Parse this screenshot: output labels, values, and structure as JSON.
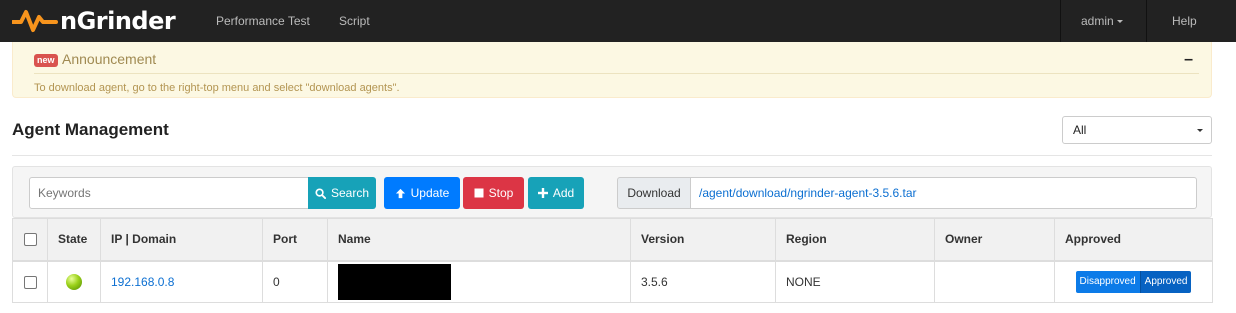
{
  "nav": {
    "brand": "nGrinder",
    "links": [
      "Performance Test",
      "Script"
    ],
    "user": "admin",
    "help": "Help"
  },
  "announcement": {
    "badge": "new",
    "title": "Announcement",
    "collapse": "–",
    "text": "To download agent, go to the right-top menu and select \"download agents\"."
  },
  "page": {
    "title": "Agent Management",
    "filter_selected": "All"
  },
  "toolbar": {
    "search_placeholder": "Keywords",
    "search_label": "Search",
    "update_label": "Update",
    "stop_label": "Stop",
    "add_label": "Add",
    "download_label": "Download",
    "download_path": "/agent/download/ngrinder-agent-3.5.6.tar"
  },
  "table": {
    "headers": [
      "State",
      "IP | Domain",
      "Port",
      "Name",
      "Version",
      "Region",
      "Owner",
      "Approved"
    ],
    "rows": [
      {
        "ip": "192.168.0.8",
        "port": "0",
        "version": "3.5.6",
        "region": "NONE",
        "owner": "",
        "approval_options": [
          "Disapproved",
          "Approved"
        ],
        "state_color": "#9bd11a"
      }
    ]
  },
  "colors": {
    "navbar": "#222222",
    "brand_accent": "#f7941d",
    "announcement_bg": "#fcf8e3",
    "search_btn": "#17a2b8",
    "update_btn": "#007bff",
    "stop_btn": "#dc3545",
    "link": "#0c6fd1"
  }
}
